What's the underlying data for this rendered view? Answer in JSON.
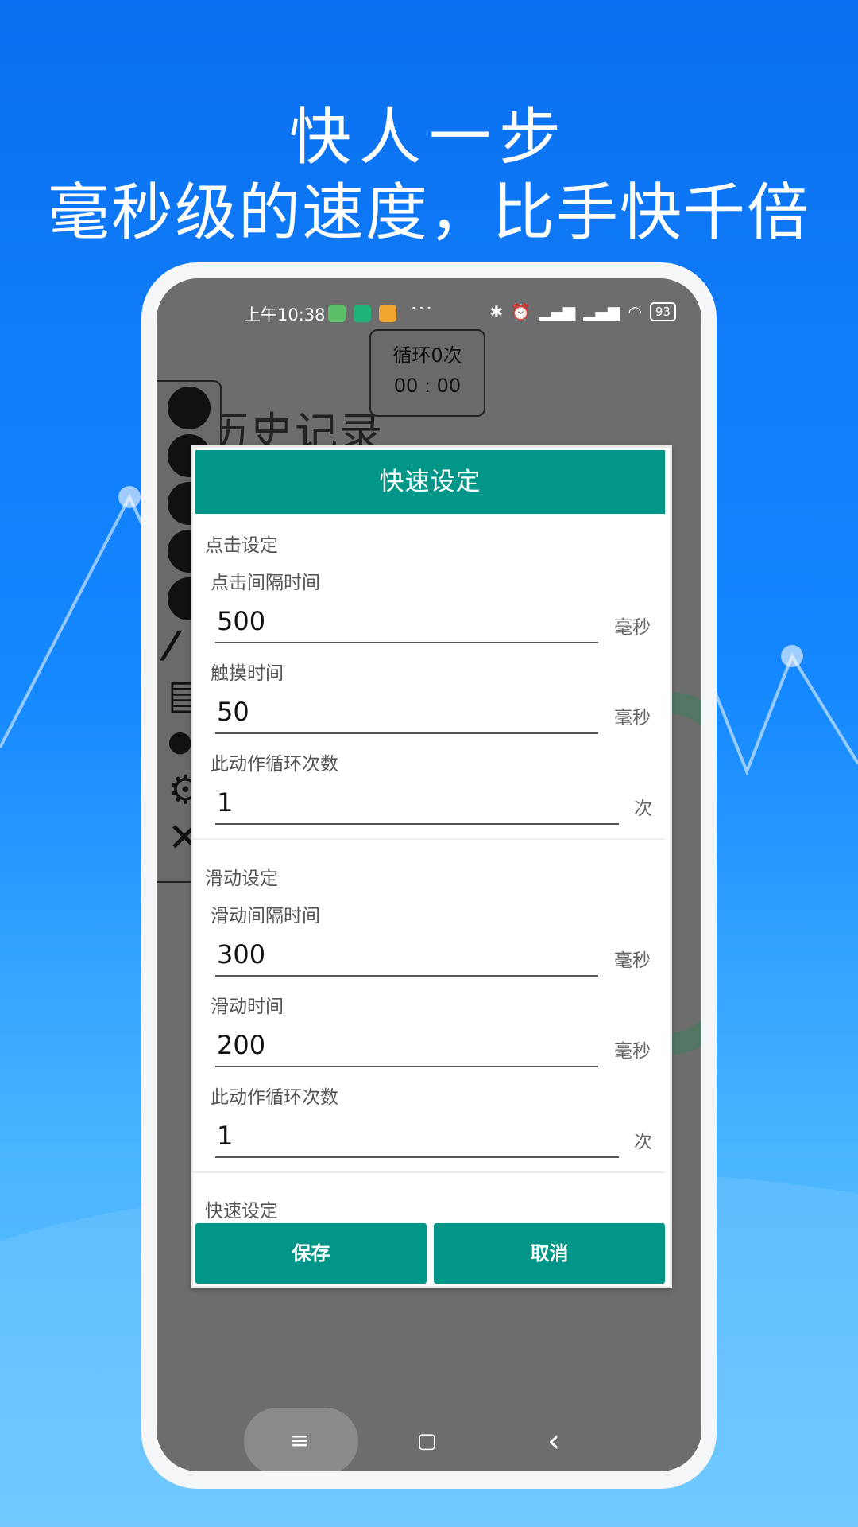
{
  "promo": {
    "headline_1": "快人一步",
    "headline_2": "毫秒级的速度，比手快千倍"
  },
  "status_bar": {
    "time": "上午10:38",
    "dots": "···",
    "battery": "93",
    "icons": [
      "bluetooth-icon",
      "alarm-icon",
      "hd-signal-icon",
      "hd-signal-icon",
      "wifi-icon",
      "battery-icon"
    ]
  },
  "counter": {
    "loop_text": "循环0次",
    "timer": "00 : 00"
  },
  "background_title": "历史记录",
  "toolbar_icons": [
    "play-icon",
    "plus-icon",
    "record-icon",
    "face-icon",
    "minus-icon",
    "line-icon",
    "list-icon",
    "eye-icon",
    "gear-icon",
    "close-icon"
  ],
  "dialog": {
    "title": "快速设定",
    "click_section": {
      "title": "点击设定",
      "interval_label": "点击间隔时间",
      "interval_value": "500",
      "interval_unit": "毫秒",
      "touch_label": "触摸时间",
      "touch_value": "50",
      "touch_unit": "毫秒",
      "loop_label": "此动作循环次数",
      "loop_value": "1",
      "loop_unit": "次"
    },
    "swipe_section": {
      "title": "滑动设定",
      "interval_label": "滑动间隔时间",
      "interval_value": "300",
      "interval_unit": "毫秒",
      "duration_label": "滑动时间",
      "duration_value": "200",
      "duration_unit": "毫秒",
      "loop_label": "此动作循环次数",
      "loop_value": "1",
      "loop_unit": "次"
    },
    "quick_section_title": "快速设定",
    "save_label": "保存",
    "cancel_label": "取消"
  },
  "navbar": {
    "menu_icon": "≡",
    "home_icon": "▢",
    "back_icon": "‹"
  },
  "colors": {
    "accent": "#029688",
    "background_top": "#0a6ff0",
    "background_bottom": "#62c4ff"
  }
}
